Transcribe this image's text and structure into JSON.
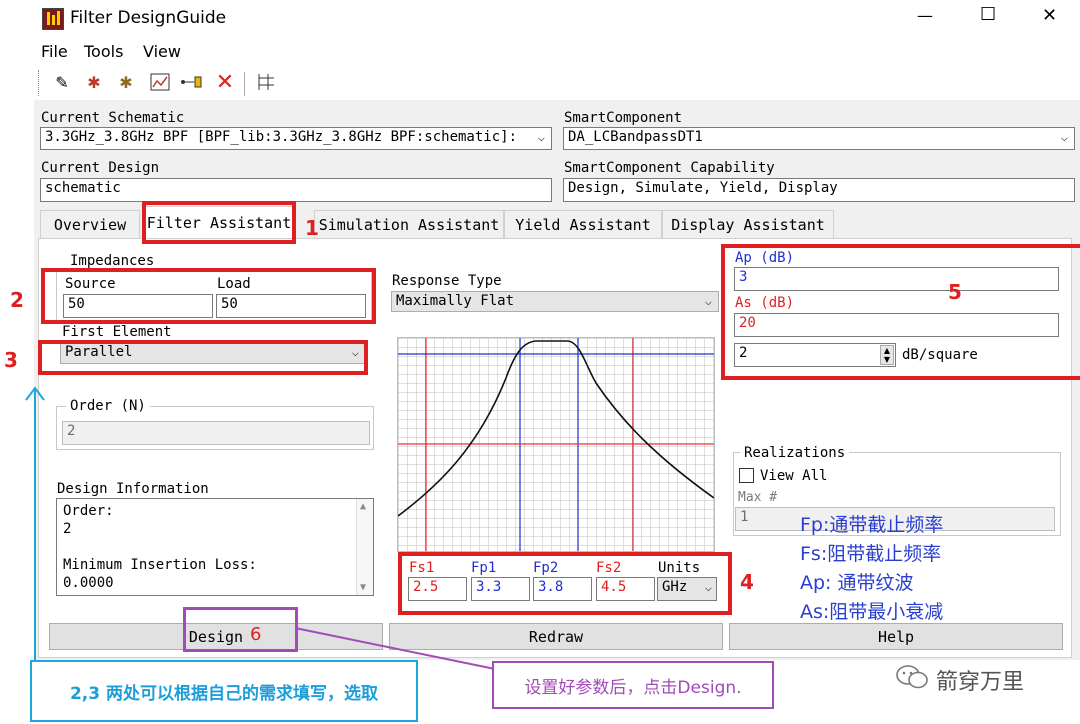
{
  "window": {
    "title": "Filter DesignGuide",
    "controls": {
      "minimize": "—",
      "maximize": "☐",
      "close": "✕"
    }
  },
  "menu": [
    "File",
    "Tools",
    "View"
  ],
  "schematic": {
    "current_schematic_label": "Current Schematic",
    "current_schematic_value": "3.3GHz_3.8GHz BPF [BPF_lib:3.3GHz_3.8GHz BPF:schematic]:",
    "smart_component_label": "SmartComponent",
    "smart_component_value": "DA_LCBandpassDT1",
    "current_design_label": "Current Design",
    "current_design_value": "schematic",
    "capability_label": "SmartComponent Capability",
    "capability_value": "Design, Simulate, Yield, Display"
  },
  "tabs": [
    "Overview",
    "Filter Assistant",
    "Simulation Assistant",
    "Yield Assistant",
    "Display Assistant"
  ],
  "impedances": {
    "group_label": "Impedances",
    "source_label": "Source",
    "source_value": "50",
    "load_label": "Load",
    "load_value": "50"
  },
  "first_element": {
    "label": "First Element",
    "value": "Parallel"
  },
  "order": {
    "label": "Order (N)",
    "value": "2"
  },
  "design_info": {
    "label": "Design Information",
    "line1": "Order:",
    "line2": "2",
    "line3": "Minimum Insertion Loss:",
    "line4": "0.0000"
  },
  "response": {
    "label": "Response Type",
    "value": "Maximally Flat"
  },
  "specs": {
    "ap_label": "Ap (dB)",
    "ap_value": "3",
    "as_label": "As (dB)",
    "as_value": "20",
    "slope_value": "2",
    "slope_unit": "dB/square"
  },
  "freq": {
    "fs1_label": "Fs1",
    "fs1_value": "2.5",
    "fp1_label": "Fp1",
    "fp1_value": "3.3",
    "fp2_label": "Fp2",
    "fp2_value": "3.8",
    "fs2_label": "Fs2",
    "fs2_value": "4.5",
    "units_label": "Units",
    "units_value": "GHz"
  },
  "realizations": {
    "label": "Realizations",
    "view_all": "View All",
    "max_label": "Max #",
    "max_value": "1"
  },
  "buttons": {
    "design": "Design",
    "redraw": "Redraw",
    "help": "Help"
  },
  "annotations": {
    "n1": "1",
    "n2": "2",
    "n3": "3",
    "n4": "4",
    "n5": "5",
    "n6": "6",
    "legend_fp": "Fp:通带截止频率",
    "legend_fs": "Fs:阻带截止频率",
    "legend_ap": "Ap:  通带纹波",
    "legend_as": "As:阻带最小衰减",
    "note_left": "2,3 两处可以根据自己的需求填写，选取",
    "note_right": "设置好参数后，点击Design.",
    "watermark": "箭穿万里"
  },
  "colors": {
    "annotation_red": "#e02020",
    "annotation_blue": "#1ea6e0",
    "annotation_purple": "#a24bb8",
    "legend_blue": "#2a3fd1"
  }
}
